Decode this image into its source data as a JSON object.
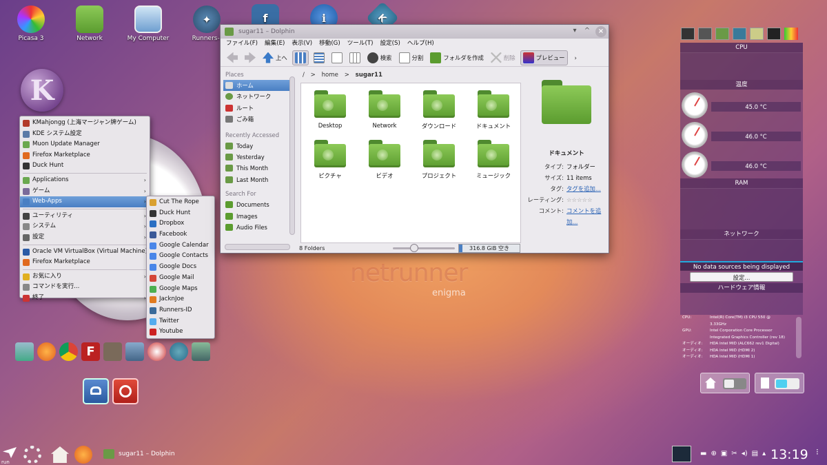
{
  "desktop_icons": [
    {
      "label": "Picasa 3",
      "icon": "picasa-icon"
    },
    {
      "label": "Network",
      "icon": "network-folder-icon"
    },
    {
      "label": "My Computer",
      "icon": "computer-icon"
    },
    {
      "label": "Runners-I",
      "icon": "runners-icon"
    },
    {
      "label": "",
      "icon": "social-icon"
    },
    {
      "label": "",
      "icon": "info-icon"
    },
    {
      "label": "",
      "icon": "kde-icon"
    }
  ],
  "menu": {
    "items": [
      {
        "label": "KMahjongg (上海マージャン牌ゲーム)",
        "icon": "mahjongg-icon",
        "color": "#b23a2a"
      },
      {
        "label": "KDE システム設定",
        "icon": "settings-icon",
        "color": "#5b7aa6"
      },
      {
        "label": "Muon Update Manager",
        "icon": "update-icon",
        "color": "#6aa84f"
      },
      {
        "label": "Firefox Marketplace",
        "icon": "firefox-icon",
        "color": "#e06a1f"
      },
      {
        "label": "Duck Hunt",
        "icon": "duckhunt-icon",
        "color": "#333333"
      },
      {
        "sep": true
      },
      {
        "label": "Applications",
        "icon": "applications-icon",
        "color": "#6aa84f",
        "sub": true
      },
      {
        "label": "ゲーム",
        "icon": "games-icon",
        "color": "#7a6a9a",
        "sub": true
      },
      {
        "label": "Web-Apps",
        "icon": "webapps-icon",
        "color": "#4a7fc3",
        "sub": true,
        "active": true
      },
      {
        "sep": true
      },
      {
        "label": "ユーティリティ",
        "icon": "utilities-icon",
        "color": "#444444",
        "sub": true
      },
      {
        "label": "システム",
        "icon": "system-icon",
        "color": "#888888",
        "sub": true
      },
      {
        "label": "設定",
        "icon": "config-icon",
        "color": "#666666",
        "sub": true
      },
      {
        "sep": true
      },
      {
        "label": "Oracle VM VirtualBox (Virtual Machine)",
        "icon": "virtualbox-icon",
        "color": "#2a5aa6"
      },
      {
        "label": "Firefox Marketplace",
        "icon": "firefox-icon",
        "color": "#e06a1f"
      },
      {
        "sep": true
      },
      {
        "label": "お気に入り",
        "icon": "favorites-icon",
        "color": "#e0b020",
        "sub": true
      },
      {
        "label": "コマンドを実行...",
        "icon": "run-icon",
        "color": "#888888"
      },
      {
        "label": "終了",
        "icon": "quit-icon",
        "color": "#cc3333",
        "sub": true
      }
    ]
  },
  "submenu": {
    "items": [
      {
        "label": "Cut The Rope",
        "color": "#d9a030"
      },
      {
        "label": "Duck Hunt",
        "color": "#333333"
      },
      {
        "label": "Dropbox",
        "color": "#2a6fc3"
      },
      {
        "label": "Facebook",
        "color": "#3b5998"
      },
      {
        "label": "Google Calendar",
        "color": "#4a86e8"
      },
      {
        "label": "Google Contacts",
        "color": "#4a86e8"
      },
      {
        "label": "Google Docs",
        "color": "#4a86e8"
      },
      {
        "label": "Google Mail",
        "color": "#d44638"
      },
      {
        "label": "Google Maps",
        "color": "#4caf50"
      },
      {
        "label": "JacknJoe",
        "color": "#e07a1f"
      },
      {
        "label": "Runners-ID",
        "color": "#3a6a9a"
      },
      {
        "label": "Twitter",
        "color": "#55acee"
      },
      {
        "label": "Youtube",
        "color": "#cc2222"
      }
    ]
  },
  "dolphin": {
    "title": "sugar11 – Dolphin",
    "menubar": [
      "ファイル(F)",
      "編集(E)",
      "表示(V)",
      "移動(G)",
      "ツール(T)",
      "設定(S)",
      "ヘルプ(H)"
    ],
    "toolbar": {
      "up": "上へ",
      "search": "検索",
      "split": "分割",
      "new_folder": "フォルダを作成",
      "delete": "削除",
      "preview": "プレビュー"
    },
    "places_header": "Places",
    "places": [
      "ホーム",
      "ネットワーク",
      "ルート",
      "ごみ箱"
    ],
    "recent_header": "Recently Accessed",
    "recent": [
      "Today",
      "Yesterday",
      "This Month",
      "Last Month"
    ],
    "search_header": "Search For",
    "search": [
      "Documents",
      "Images",
      "Audio Files"
    ],
    "breadcrumb": {
      "root": "/",
      "sep": ">",
      "home": "home",
      "current": "sugar11"
    },
    "folders": [
      "Desktop",
      "Network",
      "ダウンロード",
      "ドキュメント",
      "ピクチャ",
      "ビデオ",
      "プロジェクト",
      "ミュージック"
    ],
    "status": "8 Folders",
    "free_space": "316.8 GiB 空き",
    "info": {
      "title": "ドキュメント",
      "type_k": "タイプ:",
      "type_v": "フォルダー",
      "size_k": "サイズ:",
      "size_v": "11 items",
      "tag_k": "タグ:",
      "tag_v": "タグを追加...",
      "rating_k": "レーティング:",
      "rating_v": "☆☆☆☆☆",
      "comment_k": "コメント:",
      "comment_v1": "コメントを追",
      "comment_v2": "加..."
    }
  },
  "wallpaper": {
    "logo": "netrunner",
    "sub": "enigma"
  },
  "sidepanel": {
    "cpu": "CPU",
    "temp": "温度",
    "temps": [
      "45.0 °C",
      "46.0 °C",
      "46.0 °C"
    ],
    "ram": "RAM",
    "network": "ネットワーク",
    "no_data": "No data sources being displayed",
    "config_btn": "設定...",
    "hw_header": "ハードウェア情報",
    "hw": [
      {
        "k": "CPU:",
        "v": "Intel(R) Core(TM) i3 CPU 550 @"
      },
      {
        "k": "",
        "v": "3.33GHz"
      },
      {
        "k": "GPU:",
        "v": "Intel Corporation Core Processor"
      },
      {
        "k": "",
        "v": "Integrated Graphics Controller (rev 18)"
      },
      {
        "k": "オーディオ:",
        "v": "HDA Intel MID (ALC662 rev1 Digital)"
      },
      {
        "k": "オーディオ:",
        "v": "HDA Intel MID (HDMI 2)"
      },
      {
        "k": "オーディオ:",
        "v": "HDA Intel MID (HDMI 1)"
      }
    ]
  },
  "taskbar": {
    "run": "run",
    "task": "sugar11 – Dolphin",
    "clock": "13:19"
  }
}
